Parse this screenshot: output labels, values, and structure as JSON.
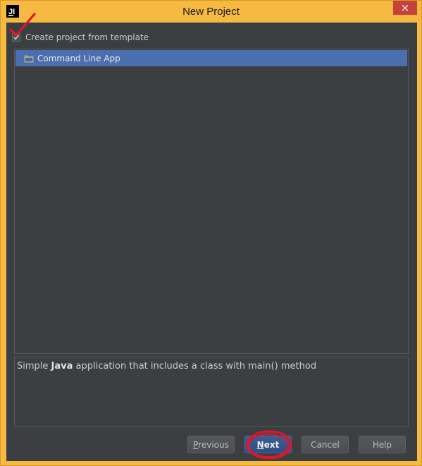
{
  "window": {
    "title": "New Project",
    "icon": "intellij-logo-icon",
    "close_glyph": "×"
  },
  "template_checkbox": {
    "label": "Create project from template",
    "checked": true
  },
  "template_list": {
    "items": [
      {
        "label": "Command Line App",
        "icon": "folder-icon",
        "selected": true
      }
    ]
  },
  "description": {
    "prefix": "Simple ",
    "bold": "Java",
    "suffix": " application that includes a class with main() method"
  },
  "buttons": {
    "previous": "Previous",
    "next": "Next",
    "cancel": "Cancel",
    "help": "Help"
  },
  "colors": {
    "frame": "#f6b941",
    "client_bg": "#3c3f41",
    "selection": "#4b6eaf",
    "close_button": "#c7423a",
    "annotation": "#e0162b"
  }
}
